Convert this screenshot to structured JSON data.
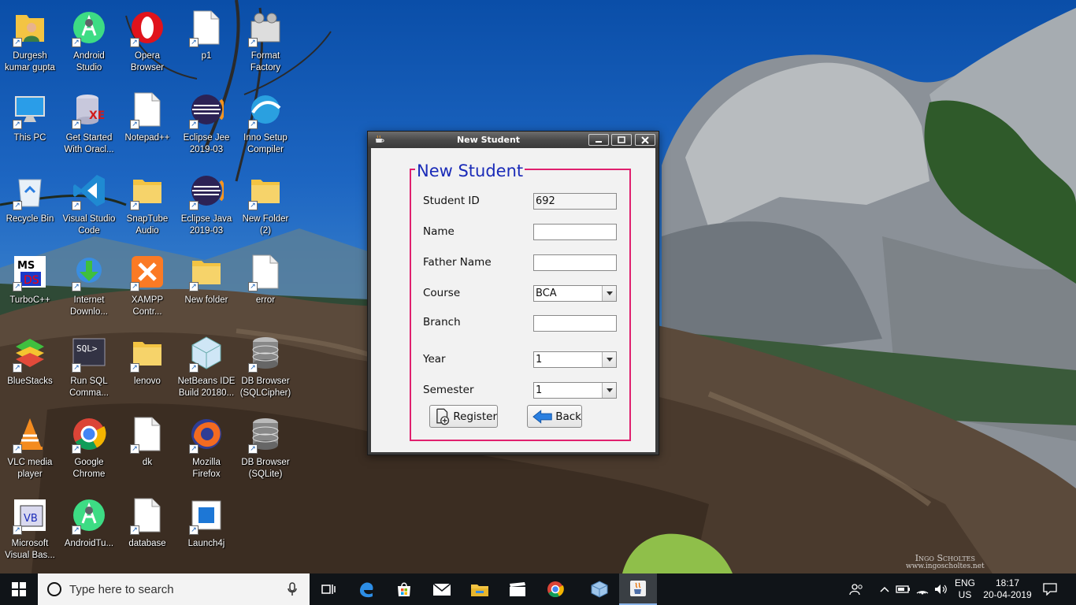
{
  "desktop": {
    "icons": [
      {
        "label": "Durgesh\nkumar gupta",
        "icon": "user-folder-icon"
      },
      {
        "label": "Android\nStudio",
        "icon": "android-studio-icon"
      },
      {
        "label": "Opera\nBrowser",
        "icon": "opera-icon"
      },
      {
        "label": "p1",
        "icon": "document-icon"
      },
      {
        "label": "Format\nFactory",
        "icon": "format-factory-icon"
      },
      {
        "label": "This PC",
        "icon": "computer-icon"
      },
      {
        "label": "Get Started\nWith Oracl...",
        "icon": "oracle-database-icon"
      },
      {
        "label": "Notepad++",
        "icon": "document-icon"
      },
      {
        "label": "Eclipse Jee\n2019-03",
        "icon": "eclipse-icon"
      },
      {
        "label": "Inno Setup\nCompiler",
        "icon": "inno-setup-icon"
      },
      {
        "label": "Recycle Bin",
        "icon": "recycle-bin-icon"
      },
      {
        "label": "Visual Studio\nCode",
        "icon": "vscode-icon"
      },
      {
        "label": "SnapTube\nAudio",
        "icon": "folder-icon"
      },
      {
        "label": "Eclipse Java\n2019-03",
        "icon": "eclipse-icon"
      },
      {
        "label": "New Folder\n(2)",
        "icon": "folder-icon"
      },
      {
        "label": "TurboC++",
        "icon": "turboc-icon"
      },
      {
        "label": "Internet\nDownlo...",
        "icon": "idm-icon"
      },
      {
        "label": "XAMPP\nContr...",
        "icon": "xampp-icon"
      },
      {
        "label": "New folder",
        "icon": "folder-icon"
      },
      {
        "label": "error",
        "icon": "document-icon"
      },
      {
        "label": "BlueStacks",
        "icon": "bluestacks-icon"
      },
      {
        "label": "Run SQL\nComma...",
        "icon": "sql-terminal-icon"
      },
      {
        "label": "lenovo",
        "icon": "folder-icon"
      },
      {
        "label": "NetBeans IDE\nBuild 20180...",
        "icon": "netbeans-icon"
      },
      {
        "label": "DB Browser\n(SQLCipher)",
        "icon": "database-icon"
      },
      {
        "label": "VLC media\nplayer",
        "icon": "vlc-icon"
      },
      {
        "label": "Google\nChrome",
        "icon": "chrome-icon"
      },
      {
        "label": "dk",
        "icon": "document-icon"
      },
      {
        "label": "Mozilla\nFirefox",
        "icon": "firefox-icon"
      },
      {
        "label": "DB Browser\n(SQLite)",
        "icon": "database-icon"
      },
      {
        "label": "Microsoft\nVisual Bas...",
        "icon": "visual-basic-icon"
      },
      {
        "label": "AndroidTu...",
        "icon": "android-studio-icon"
      },
      {
        "label": "database",
        "icon": "document-icon"
      },
      {
        "label": "Launch4j",
        "icon": "launch4j-icon"
      }
    ]
  },
  "window": {
    "title": "New Student",
    "legend": "New Student",
    "fields": {
      "student_id_label": "Student ID",
      "student_id_value": "692",
      "name_label": "Name",
      "name_value": "",
      "father_name_label": "Father Name",
      "father_name_value": "",
      "course_label": "Course",
      "course_value": "BCA",
      "branch_label": "Branch",
      "branch_value": "",
      "year_label": "Year",
      "year_value": "1",
      "semester_label": "Semester",
      "semester_value": "1"
    },
    "buttons": {
      "register": "Register",
      "back": "Back"
    }
  },
  "taskbar": {
    "search_placeholder": "Type here to search",
    "apps": [
      "task-view-icon",
      "edge-icon",
      "store-icon",
      "mail-icon",
      "file-explorer-icon",
      "movies-icon",
      "chrome-icon",
      "virtualbox-icon",
      "java-icon"
    ],
    "language_line1": "ENG",
    "language_line2": "US",
    "time": "18:17",
    "date": "20-04-2019"
  },
  "wallpaper": {
    "watermark_line1": "Ingo Scholtes",
    "watermark_line2": "www.ingoscholtes.net"
  },
  "colors": {
    "legend_text": "#1a2bb8",
    "fieldset_border": "#e0206e",
    "taskbar": "#101418"
  }
}
